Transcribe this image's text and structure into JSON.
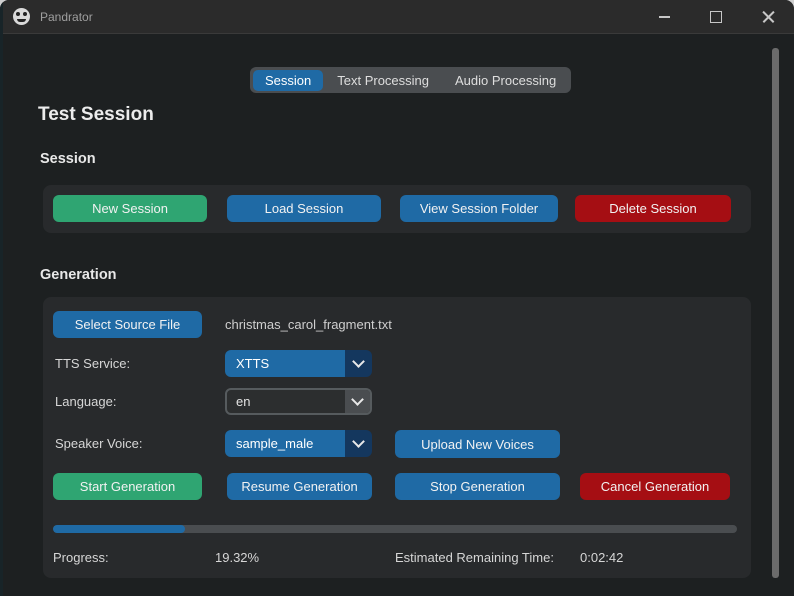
{
  "window": {
    "title": "Pandrator",
    "controls": [
      "minimize",
      "maximize",
      "close"
    ]
  },
  "icons": {
    "app_logo": "pandrator-round-logo",
    "dropdown_chevron": "chevron-down",
    "window_controls": [
      "minimize-icon",
      "maximize-icon",
      "close-icon"
    ]
  },
  "tabs": [
    {
      "label": "Session",
      "selected": true
    },
    {
      "label": "Text Processing",
      "selected": false
    },
    {
      "label": "Audio Processing",
      "selected": false
    }
  ],
  "page_title": "Test Session",
  "session": {
    "heading": "Session",
    "buttons": [
      {
        "label": "New Session",
        "variant": "green"
      },
      {
        "label": "Load Session",
        "variant": "blue"
      },
      {
        "label": "View Session Folder",
        "variant": "blue"
      },
      {
        "label": "Delete Session",
        "variant": "red"
      }
    ]
  },
  "generation": {
    "heading": "Generation",
    "select_source_button": "Select Source File",
    "source_file": "christmas_carol_fragment.txt",
    "fields": [
      {
        "label": "TTS Service:",
        "value": "XTTS",
        "type": "optionmenu"
      },
      {
        "label": "Language:",
        "value": "en",
        "type": "combobox"
      },
      {
        "label": "Speaker Voice:",
        "value": "sample_male",
        "type": "optionmenu"
      }
    ],
    "upload_button": "Upload New Voices",
    "action_buttons": [
      {
        "label": "Start Generation",
        "variant": "green"
      },
      {
        "label": "Resume Generation",
        "variant": "blue"
      },
      {
        "label": "Stop Generation",
        "variant": "blue"
      },
      {
        "label": "Cancel Generation",
        "variant": "red"
      }
    ],
    "progress": {
      "label": "Progress:",
      "percent": "19.32%",
      "fraction": 0.1932,
      "eta_label": "Estimated Remaining Time:",
      "eta": "0:02:42"
    }
  },
  "colors": {
    "page-bg": "#1d2021",
    "titlebar-bg": "#2b2b2b",
    "panel-bg": "#282a2c",
    "tab-bg": "#4a4d50",
    "blue": "#1f6aa5",
    "darkblue": "#14375e",
    "green": "#2fa572",
    "red": "#a50e13",
    "track": "#4a4d50"
  }
}
